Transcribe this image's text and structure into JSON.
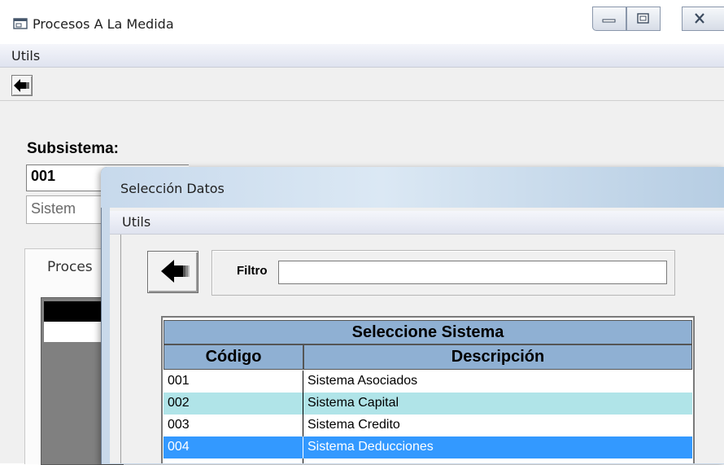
{
  "main_window": {
    "title": "Procesos A La Medida",
    "menu": {
      "utils_label": "Utils"
    },
    "subsistema": {
      "label": "Subsistema:",
      "code_value": "001",
      "description_value": "Sistem"
    },
    "tab_label": "Proces"
  },
  "dialog": {
    "title": "Selección Datos",
    "menu": {
      "utils_label": "Utils"
    },
    "filter": {
      "label": "Filtro",
      "value": ""
    },
    "grid": {
      "caption": "Seleccione Sistema",
      "columns": [
        "Código",
        "Descripción"
      ],
      "rows": [
        {
          "code": "001",
          "description": "Sistema Asociados"
        },
        {
          "code": "002",
          "description": "Sistema Capital"
        },
        {
          "code": "003",
          "description": "Sistema Credito"
        },
        {
          "code": "004",
          "description": "Sistema Deducciones"
        }
      ],
      "selected_row_index": 3
    }
  },
  "colors": {
    "grid_header": "#8fb0d3",
    "alternate_row": "#b0e4e8",
    "selected_row": "#3399ff"
  },
  "icons": {
    "app": "window-icon",
    "minimize": "minimize-icon",
    "maximize": "maximize-icon",
    "close": "close-icon",
    "back": "back-arrow-icon"
  }
}
